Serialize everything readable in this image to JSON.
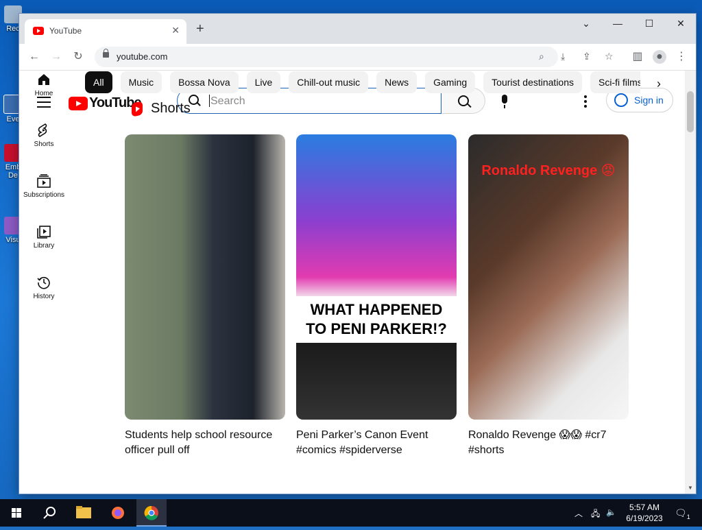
{
  "desktop": {
    "icons": [
      "Rec",
      "Eve",
      "Emb De",
      "Visu"
    ]
  },
  "browser": {
    "tab_title": "YouTube",
    "tab_close": "✕",
    "new_tab": "+",
    "url": "youtube.com"
  },
  "youtube": {
    "logo_text": "YouTube",
    "search_placeholder": "Search",
    "sign_in": "Sign in",
    "sidenav": [
      {
        "label": "Home"
      },
      {
        "label": "Shorts"
      },
      {
        "label": "Subscriptions"
      },
      {
        "label": "Library"
      },
      {
        "label": "History"
      }
    ],
    "chips": [
      "All",
      "Music",
      "Bossa Nova",
      "Live",
      "Chill-out music",
      "News",
      "Gaming",
      "Tourist destinations",
      "Sci-fi films"
    ],
    "active_chip": "All",
    "section_title": "Shorts",
    "shorts": [
      {
        "title": "Students help school resource officer pull off",
        "overlay": ""
      },
      {
        "title": "Peni Parker’s Canon Event #comics #spiderverse",
        "overlay": "WHAT HAPPENED TO PENI PARKER!?"
      },
      {
        "title": "Ronaldo Revenge 😱😱 #cr7 #shorts",
        "overlay": "Ronaldo Revenge 😡"
      }
    ]
  },
  "taskbar": {
    "time": "5:57 AM",
    "date": "6/19/2023",
    "notification_count": "1"
  },
  "colors": {
    "accent": "#065fd4",
    "youtube_red": "#ff0000",
    "chip_active": "#0f0f0f"
  }
}
